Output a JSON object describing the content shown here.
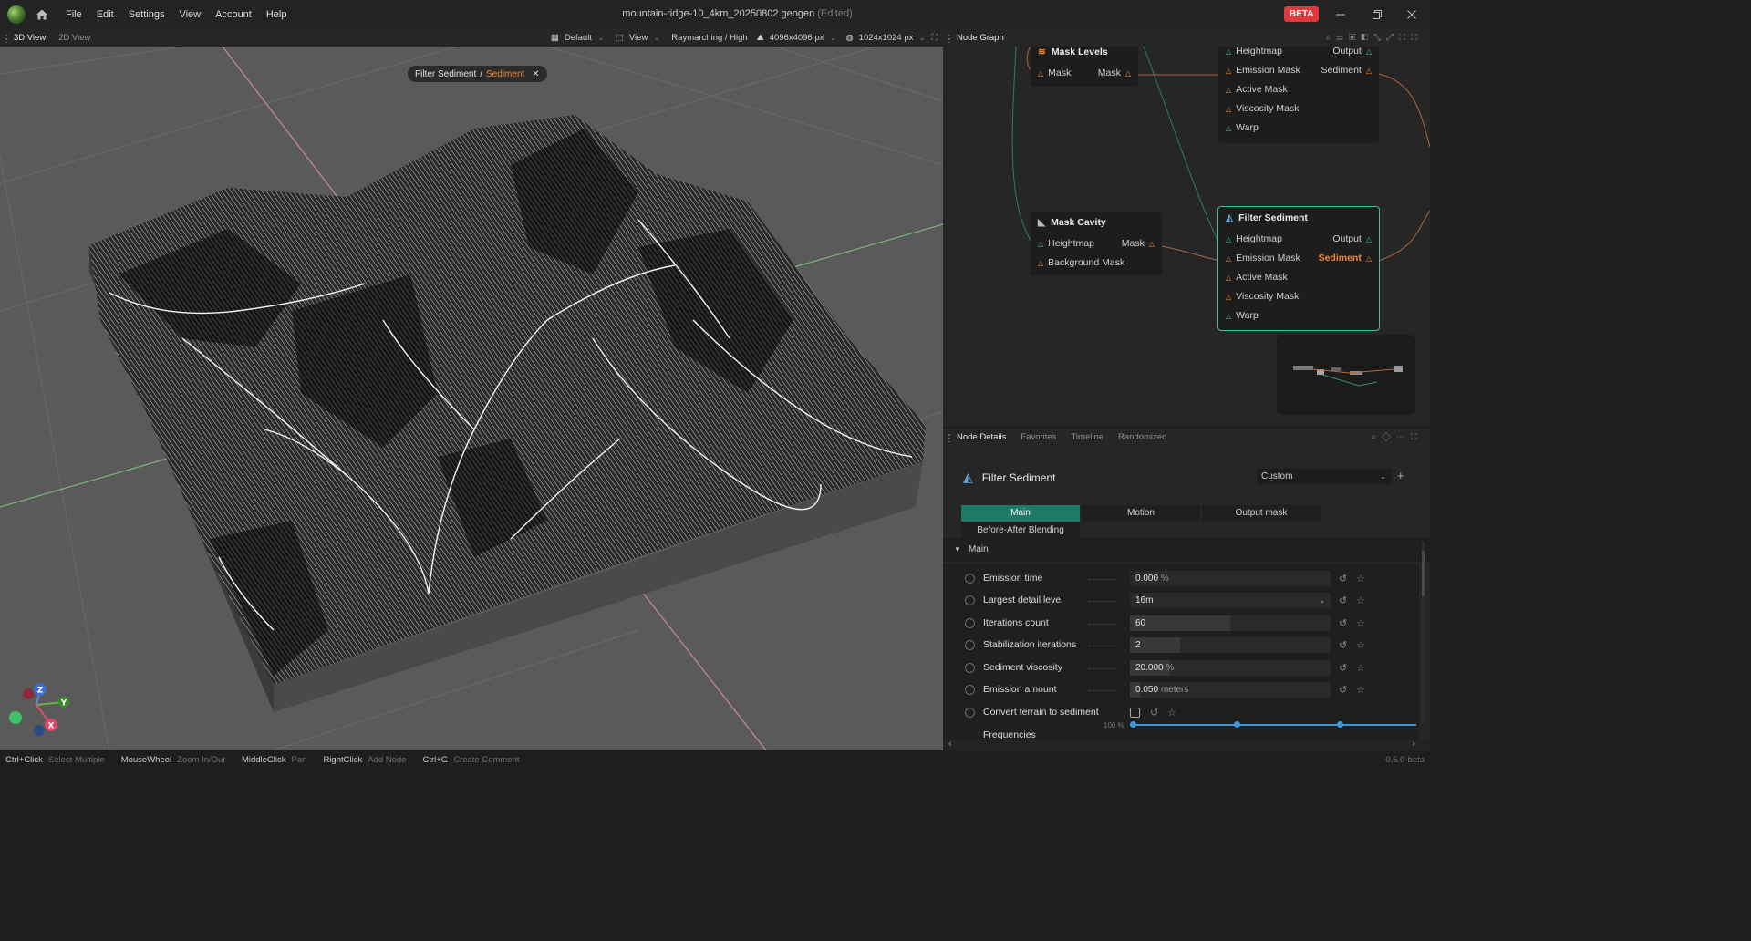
{
  "app": {
    "window_title": "mountain-ridge-10_4km_20250802.geogen",
    "edited_label": "(Edited)",
    "beta": "BETA",
    "menu": [
      "File",
      "Edit",
      "Settings",
      "View",
      "Account",
      "Help"
    ]
  },
  "viewport": {
    "tabs": [
      "3D View",
      "2D View"
    ],
    "tools": {
      "layout": "Default",
      "view": "View",
      "render_mode": "Raymarching / High",
      "resolution": "4096x4096 px",
      "preview_resolution": "1024x1024 px"
    },
    "breadcrumb": {
      "node": "Filter Sediment",
      "separator": "/",
      "output": "Sediment"
    },
    "axes": {
      "z": "Z",
      "y": "Y",
      "x": "X"
    }
  },
  "node_graph": {
    "title": "Node Graph",
    "nodes": {
      "mask_levels": {
        "title": "Mask Levels",
        "in": "Mask",
        "out": "Mask"
      },
      "top_filter": {
        "rows": [
          "Heightmap",
          "Emission Mask",
          "Active Mask",
          "Viscosity Mask",
          "Warp"
        ],
        "outputs": [
          "Output",
          "Sediment"
        ]
      },
      "mask_cavity": {
        "title": "Mask Cavity",
        "rows": [
          "Heightmap",
          "Background Mask"
        ],
        "out": "Mask"
      },
      "filter_sediment": {
        "title": "Filter Sediment",
        "rows": [
          "Heightmap",
          "Emission Mask",
          "Active Mask",
          "Viscosity Mask",
          "Warp"
        ],
        "outputs": [
          "Output",
          "Sediment"
        ]
      }
    }
  },
  "details": {
    "tabs": [
      "Node Details",
      "Favorites",
      "Timeline",
      "Randomized"
    ],
    "node_title": "Filter Sediment",
    "preset": "Custom",
    "param_tabs": [
      "Main",
      "Motion",
      "Output mask",
      "Before-After Blending"
    ],
    "section": "Main",
    "params": [
      {
        "label": "Emission time",
        "value": "0.000",
        "unit": "%",
        "fill": 0.0
      },
      {
        "label": "Largest detail level",
        "value": "16m",
        "unit": "",
        "fill": 0.0,
        "dropdown": true
      },
      {
        "label": "Iterations count",
        "value": "60",
        "unit": "",
        "fill": 0.5
      },
      {
        "label": "Stabilization iterations",
        "value": "2",
        "unit": "",
        "fill": 0.25
      },
      {
        "label": "Sediment viscosity",
        "value": "20.000",
        "unit": "%",
        "fill": 0.2
      },
      {
        "label": "Emission amount",
        "value": "0.050",
        "unit": "meters",
        "fill": 0.05
      }
    ],
    "convert_label": "Convert terrain to sediment",
    "frequencies_label": "Frequencies",
    "frequencies_scale": "100 %"
  },
  "status": {
    "hints": [
      {
        "key": "Ctrl+Click",
        "action": "Select Multiple"
      },
      {
        "key": "MouseWheel",
        "action": "Zoom In/Out"
      },
      {
        "key": "MiddleClick",
        "action": "Pan"
      },
      {
        "key": "RightClick",
        "action": "Add Node"
      },
      {
        "key": "Ctrl+G",
        "action": "Create Comment"
      }
    ],
    "version": "0.5.0-beta"
  },
  "colors": {
    "accent": "#f08a33",
    "selection": "#3fbfa0",
    "tab_active": "#1e7a67",
    "beta": "#e0383b"
  }
}
